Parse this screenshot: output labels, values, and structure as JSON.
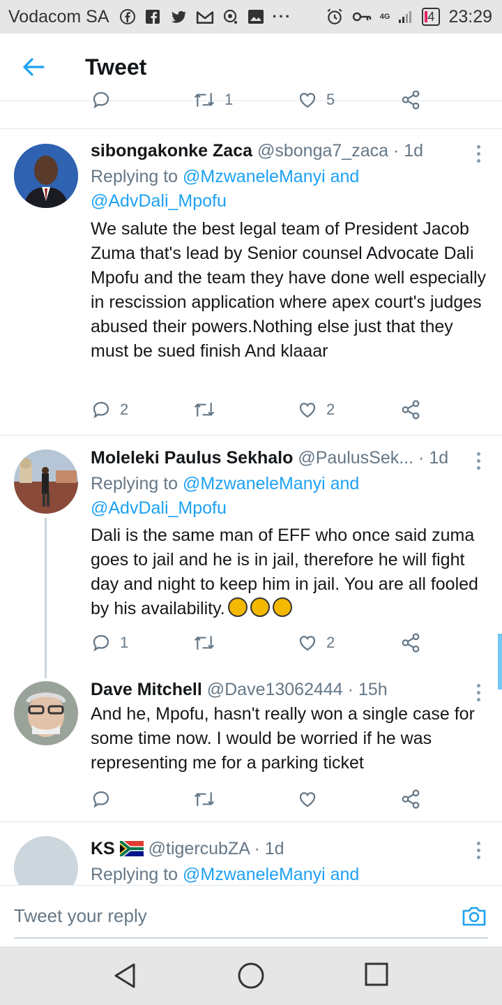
{
  "status_bar": {
    "carrier": "Vodacom SA",
    "battery": "4",
    "network": "4G",
    "time": "23:29"
  },
  "app_bar": {
    "title": "Tweet"
  },
  "previous_tweet": {
    "retweets": "1",
    "likes": "5"
  },
  "tweets": [
    {
      "name": "sibongakonke Zaca",
      "handle": "@sbonga7_zaca",
      "time": "· 1d",
      "replying_to_prefix": "Replying to ",
      "replying_to_1": "@MzwaneleManyi",
      "replying_and": " and",
      "replying_to_2": "@AdvDali_Mpofu",
      "text": "We salute the best legal team of President Jacob Zuma  that's lead by Senior counsel Advocate Dali Mpofu and the team they have done well especially in rescission application where apex court's judges abused their powers.Nothing else just that they must be sued finish And klaaar",
      "replies": "2",
      "retweets": "",
      "likes": "2"
    },
    {
      "name": "Moleleki Paulus Sekhalo",
      "handle": "@PaulusSek...",
      "time": "· 1d",
      "replying_to_prefix": "Replying to ",
      "replying_to_1": "@MzwaneleManyi",
      "replying_and": " and",
      "replying_to_2": "@AdvDali_Mpofu",
      "text": "Dali is the same man of EFF who once said zuma goes to jail and he is in jail, therefore he will fight day and night to keep him in jail. You are all fooled by his availability.",
      "emoji_count": 3,
      "replies": "1",
      "retweets": "",
      "likes": "2"
    },
    {
      "name": "Dave Mitchell",
      "handle": "@Dave13062444",
      "time": "· 15h",
      "text": "And he, Mpofu,  hasn't really won a single case for some time now. I would be worried if he was representing me for a parking ticket",
      "replies": "",
      "retweets": "",
      "likes": ""
    },
    {
      "name": "KS",
      "handle": "@tigercubZA",
      "time": "· 1d",
      "replying_to_prefix": "Replying to ",
      "replying_to_1": "@MzwaneleManyi",
      "replying_and": " and"
    }
  ],
  "reply_bar": {
    "placeholder": "Tweet your reply"
  },
  "colors": {
    "accent": "#1da1f2",
    "text": "#14171a",
    "muted": "#657786"
  }
}
